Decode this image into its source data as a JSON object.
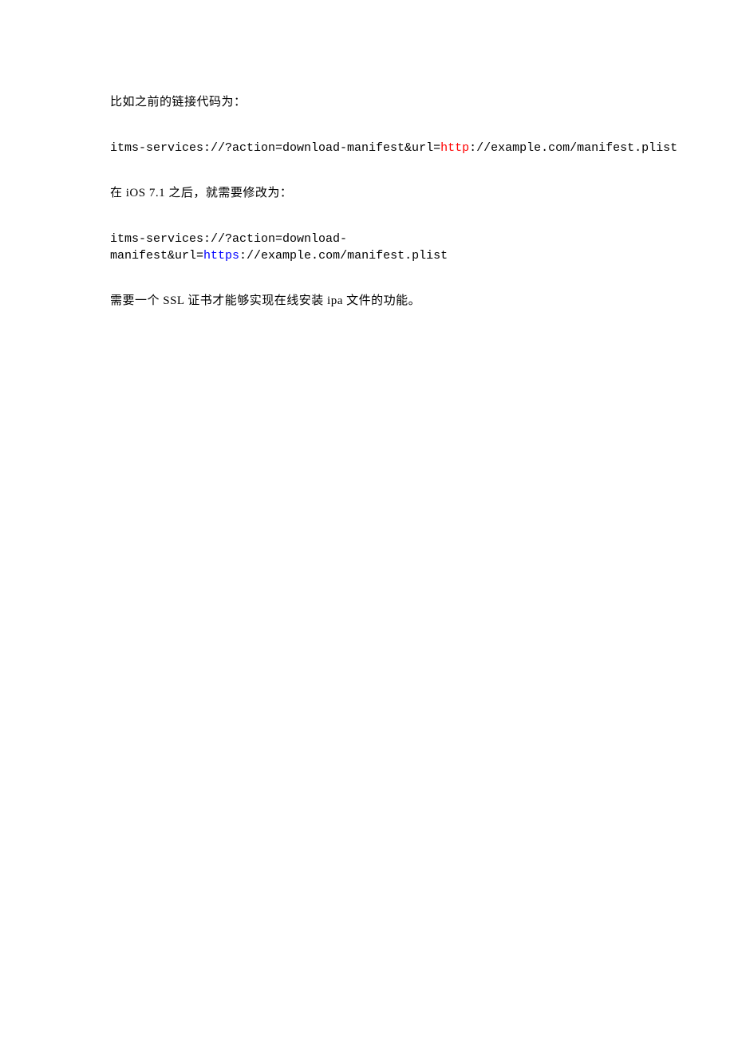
{
  "para1": "比如之前的链接代码为：",
  "line1_prefix": "itms-services://?action=download-manifest&url=",
  "line1_proto": "http",
  "line1_suffix": "://example.com/manifest.plist",
  "para2": "在 iOS 7.1 之后，就需要修改为：",
  "line2_prefix": "itms-services://?action=download-manifest&url=",
  "line2_proto": "https",
  "line2_suffix": "://example.com/manifest.plist",
  "para3": "需要一个 SSL 证书才能够实现在线安装 ipa 文件的功能。"
}
